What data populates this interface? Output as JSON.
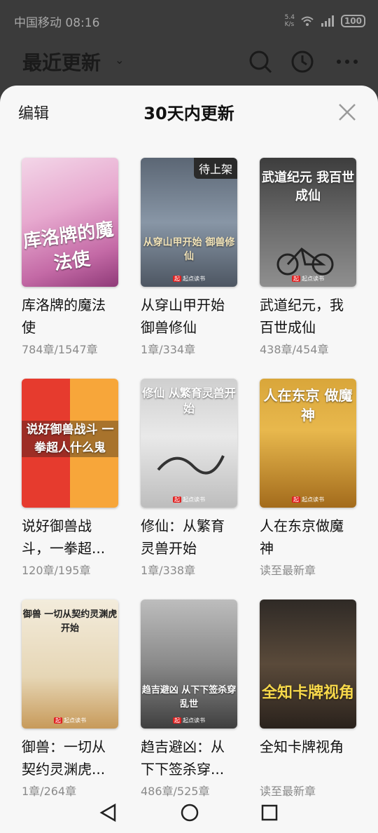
{
  "status_bar": {
    "carrier_time": "中国移动 08:16",
    "net_speed_value": "5.4",
    "net_speed_unit": "K/s",
    "battery": "100"
  },
  "background_app": {
    "title": "最近更新",
    "chevron": "⌄"
  },
  "sheet": {
    "edit_label": "编辑",
    "title": "30天内更新"
  },
  "books": [
    {
      "title": "库洛牌的魔法使",
      "progress": "784章/1547章",
      "cover_text": "库洛牌的魔法使",
      "tag": ""
    },
    {
      "title": "从穿山甲开始御兽修仙",
      "progress": "1章/334章",
      "cover_text": "从穿山甲开始 御兽修仙",
      "tag": "待上架"
    },
    {
      "title": "武道纪元，我百世成仙",
      "progress": "438章/454章",
      "cover_text": "武道纪元 我百世成仙",
      "tag": ""
    },
    {
      "title": "说好御兽战斗，一拳超...",
      "progress": "120章/195章",
      "cover_text": "说好御兽战斗 一拳超人什么鬼",
      "tag": ""
    },
    {
      "title": "修仙：从繁育灵兽开始",
      "progress": "1章/338章",
      "cover_text": "修仙 从繁育灵兽开始",
      "tag": ""
    },
    {
      "title": "人在东京做魔神",
      "progress": "读至最新章",
      "cover_text": "人在东京 做魔神",
      "tag": ""
    },
    {
      "title": "御兽：一切从契约灵渊虎...",
      "progress": "1章/264章",
      "cover_text": "御兽 一切从契约灵渊虎开始",
      "tag": ""
    },
    {
      "title": "趋吉避凶：从下下签杀穿...",
      "progress": "486章/525章",
      "cover_text": "趋吉避凶 从下下签杀穿乱世",
      "tag": ""
    },
    {
      "title": "全知卡牌视角",
      "progress": "读至最新章",
      "cover_text": "全知卡牌视角",
      "tag": ""
    }
  ],
  "publisher": "起点读书",
  "colors": {
    "sheet_bg": "#f7f7f7",
    "dim_bg": "#3b3b3b",
    "progress_text": "#8a8a8a"
  }
}
